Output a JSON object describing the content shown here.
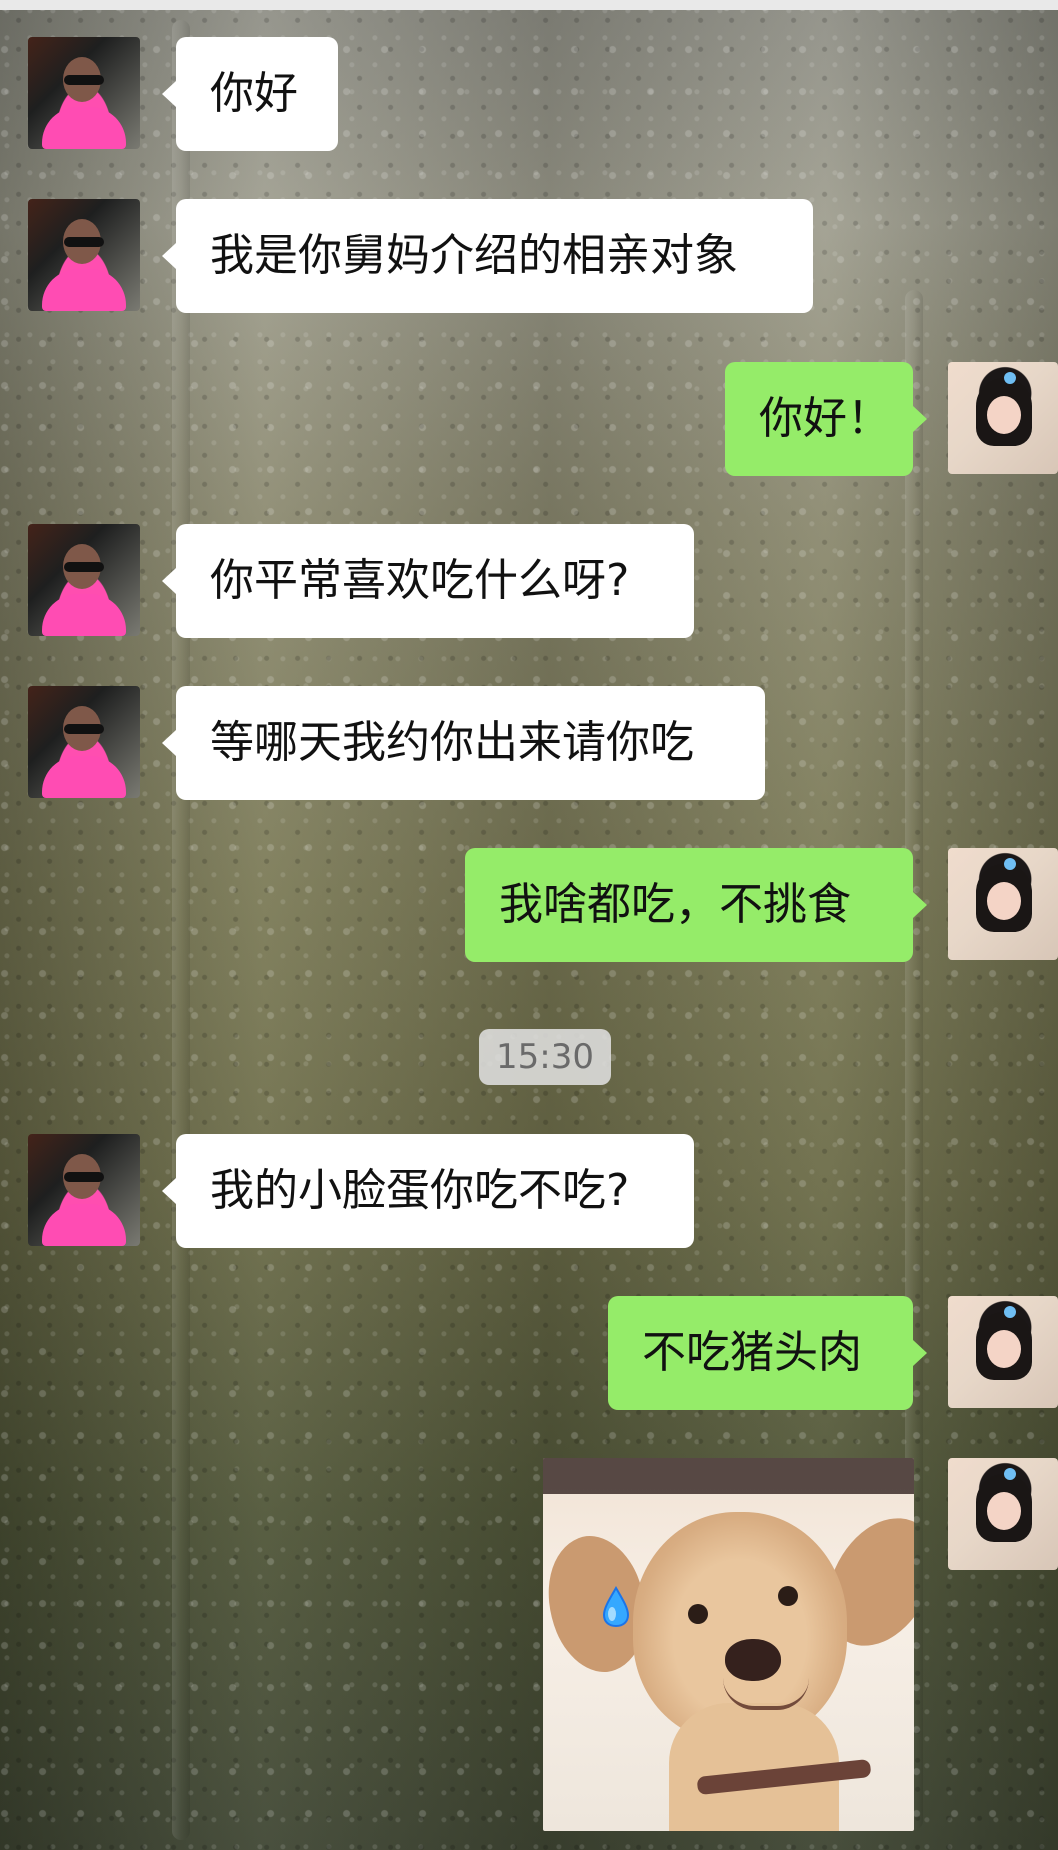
{
  "chat": {
    "time_label": "15:30",
    "messages": [
      {
        "sender": "male",
        "text": "你好"
      },
      {
        "sender": "male",
        "text": "我是你舅妈介绍的相亲对象"
      },
      {
        "sender": "female",
        "text": "你好！"
      },
      {
        "sender": "male",
        "text": "你平常喜欢吃什么呀?"
      },
      {
        "sender": "male",
        "text": "等哪天我约你出来请你吃"
      },
      {
        "sender": "female",
        "text": "我啥都吃，不挑食"
      },
      {
        "sender": "male",
        "text": "我的小脸蛋你吃不吃?"
      },
      {
        "sender": "female",
        "text": "不吃猪头肉"
      }
    ],
    "image_message": {
      "sender": "female",
      "icon": "dog-meme-icon"
    }
  },
  "colors": {
    "left_bubble": "#ffffff",
    "right_bubble": "#95ec69",
    "timestamp_bg": "#e2e2e2"
  },
  "avatars": {
    "male_icon": "man-avatar-icon",
    "female_icon": "girl-avatar-icon"
  }
}
